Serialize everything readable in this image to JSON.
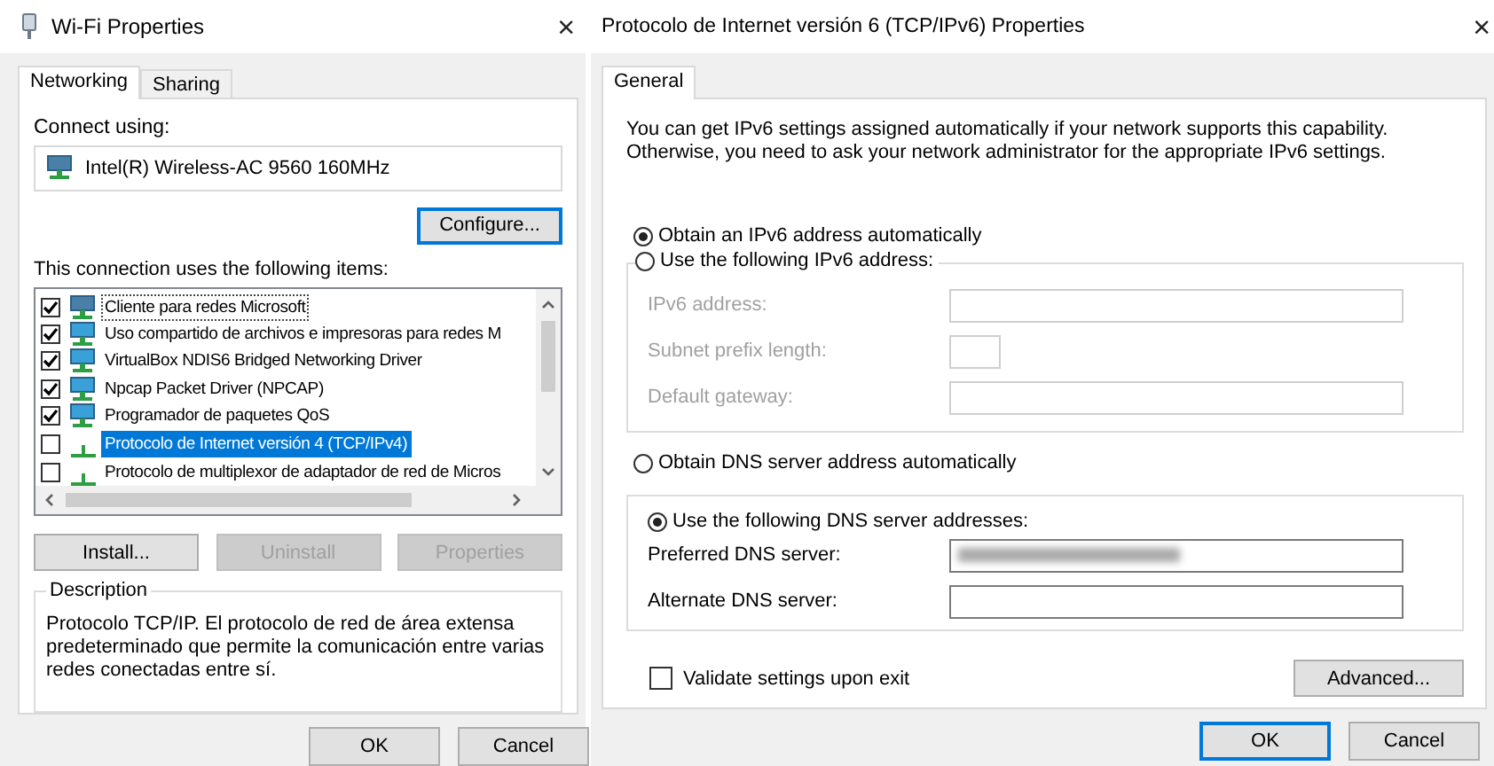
{
  "left_window": {
    "title": "Wi-Fi Properties",
    "close": "×",
    "tabs": [
      {
        "label": "Networking",
        "selected": true
      },
      {
        "label": "Sharing",
        "selected": false
      }
    ],
    "connect_using_label": "Connect using:",
    "adapter": "Intel(R) Wireless-AC 9560 160MHz",
    "configure_button": {
      "label": "Configure...",
      "focused": true
    },
    "items_label": "This connection uses the following items:",
    "items": [
      {
        "label": "Cliente para redes Microsoft",
        "kind": "client",
        "checked": true,
        "selected": false,
        "focused": true
      },
      {
        "label": "Uso compartido de archivos e impresoras para redes M",
        "kind": "service",
        "checked": true,
        "selected": false,
        "focused": false
      },
      {
        "label": "VirtualBox NDIS6 Bridged Networking Driver",
        "kind": "service",
        "checked": true,
        "selected": false,
        "focused": false
      },
      {
        "label": "Npcap Packet Driver (NPCAP)",
        "kind": "service",
        "checked": true,
        "selected": false,
        "focused": false
      },
      {
        "label": "Programador de paquetes QoS",
        "kind": "service",
        "checked": true,
        "selected": false,
        "focused": false
      },
      {
        "label": "Protocolo de Internet versión 4 (TCP/IPv4)",
        "kind": "protocol",
        "checked": false,
        "selected": true,
        "focused": false
      },
      {
        "label": "Protocolo de multiplexor de adaptador de red de Micros",
        "kind": "protocol",
        "checked": false,
        "selected": false,
        "focused": false
      }
    ],
    "action_buttons": [
      {
        "label": "Install...",
        "disabled": false
      },
      {
        "label": "Uninstall",
        "disabled": true
      },
      {
        "label": "Properties",
        "disabled": true
      }
    ],
    "description": {
      "title": "Description",
      "text": "Protocolo TCP/IP. El protocolo de red de área extensa predeterminado que permite la comunicación entre varias redes conectadas entre sí."
    },
    "dialog_buttons": [
      {
        "label": "OK",
        "default": false
      },
      {
        "label": "Cancel",
        "default": false
      }
    ]
  },
  "right_window": {
    "title": "Protocolo de Internet versión 6 (TCP/IPv6) Properties",
    "close": "×",
    "tabs": [
      {
        "label": "General",
        "selected": true
      }
    ],
    "intro": "You can get IPv6 settings assigned automatically if your network supports this capability. Otherwise, you need to ask your network administrator for the appropriate IPv6 settings.",
    "address_options": [
      {
        "label": "Obtain an IPv6 address automatically",
        "selected": true
      },
      {
        "label": "Use the following IPv6 address:",
        "selected": false
      }
    ],
    "address_fields": [
      {
        "label": "IPv6 address:",
        "kind": "wide",
        "disabled": true
      },
      {
        "label": "Subnet prefix length:",
        "kind": "narrow",
        "disabled": true
      },
      {
        "label": "Default gateway:",
        "kind": "wide",
        "disabled": true
      }
    ],
    "dns_options": [
      {
        "label": "Obtain DNS server address automatically",
        "selected": false
      },
      {
        "label": "Use the following DNS server addresses:",
        "selected": true
      }
    ],
    "dns_fields": [
      {
        "label": "Preferred DNS server:",
        "disabled": false,
        "redacted": true
      },
      {
        "label": "Alternate DNS server:",
        "disabled": false,
        "redacted": false
      }
    ],
    "validate_checkbox": {
      "label": "Validate settings upon exit",
      "checked": false
    },
    "advanced_button": "Advanced...",
    "dialog_buttons": [
      {
        "label": "OK",
        "default": true
      },
      {
        "label": "Cancel",
        "default": false
      }
    ]
  }
}
